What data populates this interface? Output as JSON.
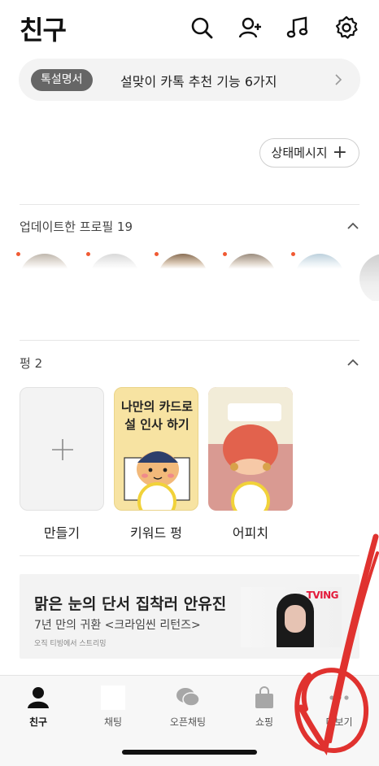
{
  "header": {
    "title": "친구",
    "icons": [
      "search-icon",
      "add-friend-icon",
      "music-icon",
      "settings-icon"
    ]
  },
  "banner": {
    "badge": "톡설명서",
    "text": "설맞이 카톡 추천 기능 6가지"
  },
  "status_button": {
    "label": "상태메시지",
    "plus": "+"
  },
  "updated_profiles": {
    "label": "업데이트한 프로필 19",
    "count": 6
  },
  "pung": {
    "label": "펑 2",
    "cards": [
      {
        "caption": "만들기"
      },
      {
        "caption": "키워드 펑",
        "card_text": "나만의 카드로 설 인사 하기"
      },
      {
        "caption": "어피치"
      }
    ]
  },
  "ad": {
    "title": "맑은 눈의 단서 집착러 안유진",
    "subtitle": "7년 만의 귀환 <크라임씬 리턴즈>",
    "small": "오직 티빙에서 스트리밍",
    "brand": "TVING"
  },
  "tabbar": {
    "tabs": [
      {
        "label": "친구",
        "icon": "person-icon"
      },
      {
        "label": "채팅",
        "icon": "chat-icon"
      },
      {
        "label": "오픈채팅",
        "icon": "open-chat-icon"
      },
      {
        "label": "쇼핑",
        "icon": "shopping-bag-icon"
      },
      {
        "label": "더보기",
        "icon": "more-icon"
      }
    ]
  },
  "colors": {
    "accent_red": "#e31b3b",
    "new_dot": "#f05a33",
    "pung_ring": "#f1d23a",
    "annotation": "#e0322f"
  }
}
